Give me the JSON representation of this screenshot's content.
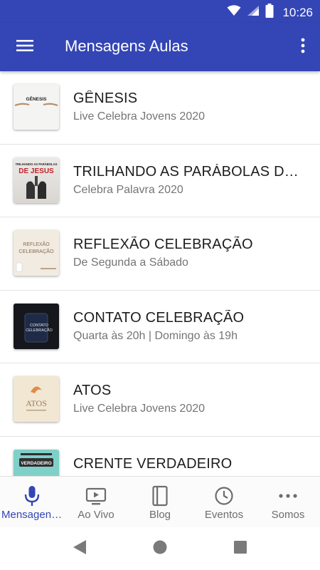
{
  "status": {
    "time": "10:26"
  },
  "app_bar": {
    "title": "Mensagens Aulas"
  },
  "items": [
    {
      "title": "GÊNESIS",
      "subtitle": "Live Celebra Jovens 2020",
      "thumb_text": "GÊNESIS"
    },
    {
      "title": "TRILHANDO AS PARÁBOLAS DE JESUS",
      "subtitle": "Celebra Palavra 2020",
      "thumb_text_top": "TRILHANDO AS PARÁBOLAS",
      "thumb_text_main": "DE JESUS"
    },
    {
      "title": "REFLEXÃO CELEBRAÇÃO",
      "subtitle": "De Segunda a Sábado",
      "thumb_text_top": "REFLEXÃO",
      "thumb_text_main": "CELEBRAÇÃO"
    },
    {
      "title": "CONTATO CELEBRAÇÃO",
      "subtitle": "Quarta às 20h | Domingo às 19h",
      "thumb_text_top": "CONTATO",
      "thumb_text_main": "CELEBRAÇÃO"
    },
    {
      "title": "ATOS",
      "subtitle": "Live Celebra Jovens 2020",
      "thumb_text": "ATOS"
    },
    {
      "title": "CRENTE VERDADEIRO",
      "subtitle": "",
      "thumb_text": "VERDADEIRO"
    }
  ],
  "bottom_nav": [
    {
      "label": "Mensagens Aulas",
      "icon": "microphone-icon",
      "active": true
    },
    {
      "label": "Ao Vivo",
      "icon": "live-tv-icon"
    },
    {
      "label": "Blog",
      "icon": "book-icon"
    },
    {
      "label": "Eventos",
      "icon": "clock-icon"
    },
    {
      "label": "Somos",
      "icon": "more-horizontal-icon"
    }
  ],
  "colors": {
    "primary": "#3446b5",
    "active_nav": "#3446b5",
    "inactive_nav": "#6d6d6d"
  }
}
